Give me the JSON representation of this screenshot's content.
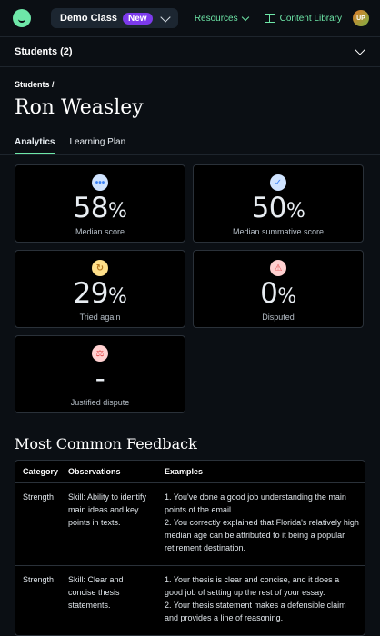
{
  "topbar": {
    "class_name": "Demo Class",
    "class_badge": "New",
    "resources_label": "Resources",
    "content_library_label": "Content Library",
    "avatar_initials": "UP"
  },
  "students_selector": {
    "label": "Students (2)"
  },
  "header": {
    "breadcrumb": "Students /",
    "title": "Ron Weasley",
    "tabs": [
      {
        "label": "Analytics",
        "active": true
      },
      {
        "label": "Learning Plan",
        "active": false
      }
    ]
  },
  "stats": [
    {
      "icon": "dots-icon",
      "icon_glyph": "•••",
      "icon_bg": "#cfe3ff",
      "icon_fg": "#3b82f6",
      "value": "58",
      "unit": "%",
      "caption": "Median score"
    },
    {
      "icon": "check-circle-icon",
      "icon_glyph": "✓",
      "icon_bg": "#cfe3ff",
      "icon_fg": "#3b82f6",
      "value": "50",
      "unit": "%",
      "caption": "Median summative score"
    },
    {
      "icon": "retry-icon",
      "icon_glyph": "↻",
      "icon_bg": "#ffe08a",
      "icon_fg": "#b7791f",
      "value": "29",
      "unit": "%",
      "caption": "Tried again"
    },
    {
      "icon": "warning-icon",
      "icon_glyph": "⚠",
      "icon_bg": "#ffd0d0",
      "icon_fg": "#e24b4b",
      "value": "0",
      "unit": "%",
      "caption": "Disputed"
    },
    {
      "icon": "scales-icon",
      "icon_glyph": "⚖",
      "icon_bg": "#ffd0d0",
      "icon_fg": "#e24b4b",
      "value": "-",
      "unit": "",
      "caption": "Justified dispute"
    }
  ],
  "feedback": {
    "title": "Most Common Feedback",
    "columns": [
      "Category",
      "Observations",
      "Examples"
    ],
    "rows": [
      {
        "category": "Strength",
        "observation": "Skill: Ability to identify main ideas and key points in texts.",
        "examples": [
          "1. You've done a good job understanding the main points of the email.",
          "2. You correctly explained that Florida's relatively high median age can be attributed to it being a popular retirement destination."
        ]
      },
      {
        "category": "Strength",
        "observation": "Skill: Clear and concise thesis statements.",
        "examples": [
          "1. Your thesis is clear and concise, and it does a good job of setting up the rest of your essay.",
          "2. Your thesis statement makes a defensible claim and provides a line of reasoning."
        ]
      }
    ]
  },
  "colors": {
    "accent": "#6ee7a8",
    "badge": "#7c3aed",
    "background": "#0b0f14"
  }
}
